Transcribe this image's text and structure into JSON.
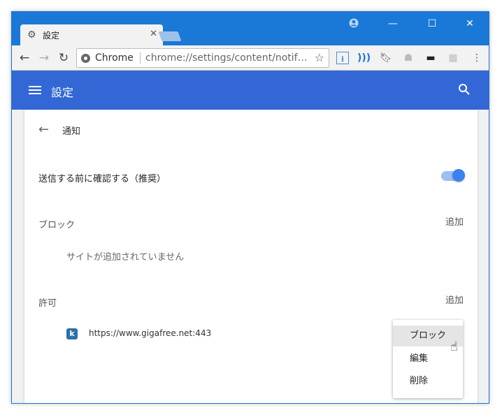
{
  "browser": {
    "tab": {
      "icon": "gear-icon",
      "title": "設定",
      "close": "✕"
    },
    "window_controls": {
      "user": "account-icon",
      "minimize": "—",
      "maximize": "☐",
      "close": "✕"
    },
    "toolbar": {
      "omnibox": {
        "site_name": "Chrome",
        "url": "chrome://settings/content/notif…"
      },
      "extensions": [
        "download-icon",
        "wifi-icon",
        "bookmark-icon",
        "ghost-icon",
        "mask-icon",
        "puzzle-icon",
        "menu-dots-icon"
      ]
    }
  },
  "settings": {
    "header_title": "設定",
    "page_title": "通知",
    "ask_before_sending": {
      "label": "送信する前に確認する（推奨）",
      "enabled": true
    },
    "block": {
      "label": "ブロック",
      "add": "追加",
      "empty": "サイトが追加されていません"
    },
    "allow": {
      "label": "許可",
      "add": "追加",
      "sites": [
        {
          "url": "https://www.gigafree.net:443",
          "icon": "k"
        }
      ]
    },
    "popup_menu": {
      "items": [
        "ブロック",
        "編集",
        "削除"
      ],
      "highlighted": 0
    }
  },
  "colors": {
    "titlebar": "#1a78d7",
    "settings_header": "#3367d6",
    "toggle_on": "#3b82f0"
  }
}
